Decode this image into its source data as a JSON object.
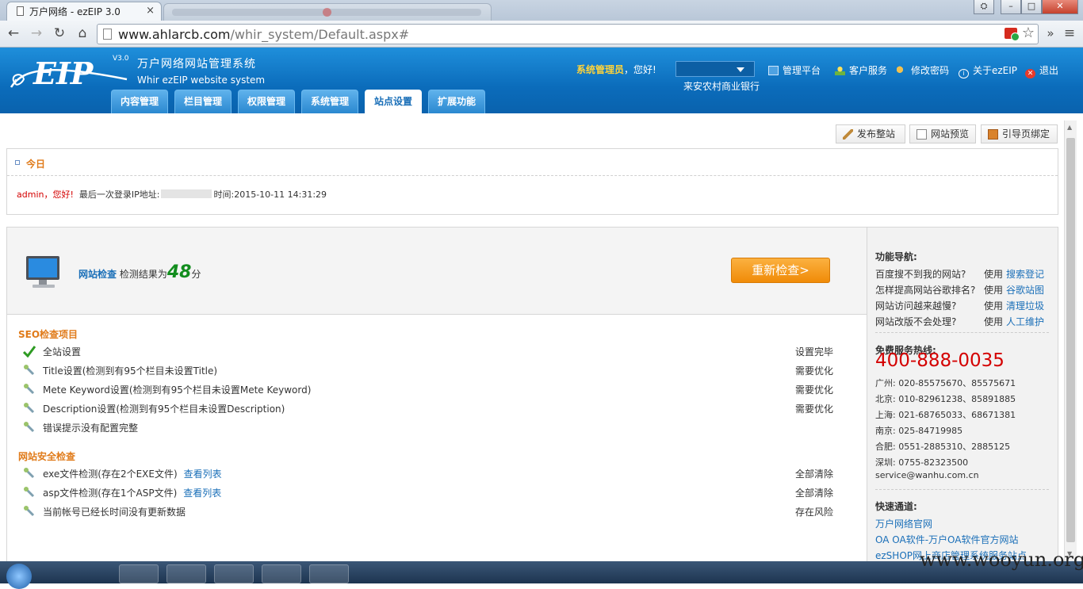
{
  "browser": {
    "tab_title": "万户网络 - ezEIP 3.0",
    "tab_close": "×",
    "url_host": "www.ahlarcb.com",
    "url_path": "/whir_system/Default.aspx#",
    "nav_back": "←",
    "nav_forward": "→",
    "nav_reload": "↻",
    "nav_home": "⌂",
    "menu_more": "»",
    "menu_wrench": "≡",
    "win_minimize": "–",
    "win_maximize": "□",
    "win_close": "✕",
    "star": "☆"
  },
  "header": {
    "logo_text": "EIP",
    "logo_version": "V3.0",
    "logo_title": "万户网络网站管理系统",
    "logo_subtitle": "Whir ezEIP website system",
    "user_role": "系统管理员",
    "user_greeting": "，您好!",
    "site_name": "来安农村商业银行",
    "links": [
      {
        "label": "管理平台",
        "icon": "monitor-icon"
      },
      {
        "label": "客户服务",
        "icon": "user-icon"
      },
      {
        "label": "修改密码",
        "icon": "key-icon"
      },
      {
        "label": "关于ezEIP",
        "icon": "info-icon"
      },
      {
        "label": "退出",
        "icon": "exit-icon"
      }
    ],
    "tabs": [
      "内容管理",
      "栏目管理",
      "权限管理",
      "系统管理",
      "站点设置",
      "扩展功能"
    ],
    "active_tab": "站点设置"
  },
  "toolbar": {
    "publish": "发布整站",
    "preview": "网站预览",
    "bind": "引导页绑定"
  },
  "today": {
    "title": "今日",
    "user": "admin，您好!",
    "last_login_label": "最后一次登录IP地址:",
    "time_label": "时间:",
    "time_value": "2015-10-11 14:31:29"
  },
  "check": {
    "link": "网站检查",
    "result_prefix": " 检测结果为",
    "score": "48",
    "unit": "分",
    "recheck_button": "重新检查>",
    "seo_title": "SEO检查项目",
    "seo_items": [
      {
        "text": "全站设置",
        "status": "设置完毕",
        "ok": true
      },
      {
        "text": "Title设置(检测到有95个栏目未设置Title)",
        "status": "需要优化",
        "ok": false
      },
      {
        "text": "Mete Keyword设置(检测到有95个栏目未设置Mete Keyword)",
        "status": "需要优化",
        "ok": false
      },
      {
        "text": "Description设置(检测到有95个栏目未设置Description)",
        "status": "需要优化",
        "ok": false
      },
      {
        "text": "错误提示没有配置完整",
        "status": "",
        "ok": false
      }
    ],
    "security_title": "网站安全检查",
    "security_items": [
      {
        "text": "exe文件检测(存在2个EXE文件)",
        "link": "查看列表",
        "status": "全部清除"
      },
      {
        "text": "asp文件检测(存在1个ASP文件)",
        "link": "查看列表",
        "status": "全部清除"
      },
      {
        "text": "当前帐号已经长时间没有更新数据",
        "link": "",
        "status": "存在风险"
      }
    ]
  },
  "sidebar": {
    "nav_title": "功能导航:",
    "questions": [
      {
        "q": "百度搜不到我的网站?",
        "use": "使用",
        "action": "搜索登记"
      },
      {
        "q": "怎样提高网站谷歌排名?",
        "use": "使用",
        "action": "谷歌站图"
      },
      {
        "q": "网站访问越来越慢?",
        "use": "使用",
        "action": "清理垃圾"
      },
      {
        "q": "网站改版不会处理?",
        "use": "使用",
        "action": "人工维护"
      }
    ],
    "hotline_title": "免费服务热线:",
    "hotline": "400-888-0035",
    "cities": [
      "广州: 020-85575670、85575671",
      "北京: 010-82961238、85891885",
      "上海: 021-68765033、68671381",
      "南京: 025-84719985",
      "合肥: 0551-2885310、2885125",
      "深圳: 0755-82323500"
    ],
    "email": "service@wanhu.com.cn",
    "quick_title": "快速通道:",
    "quick_links": [
      "万户网络官网",
      "OA OA软件-万户OA软件官方网站",
      "ezSHOP网上商店管理系统服务站点"
    ]
  },
  "watermark": "www.wooyun.org",
  "colors": {
    "header_blue": "#0b6cbb",
    "accent_orange": "#e07b1a",
    "hotline_red": "#d40000",
    "link_blue": "#1a6fb8"
  }
}
